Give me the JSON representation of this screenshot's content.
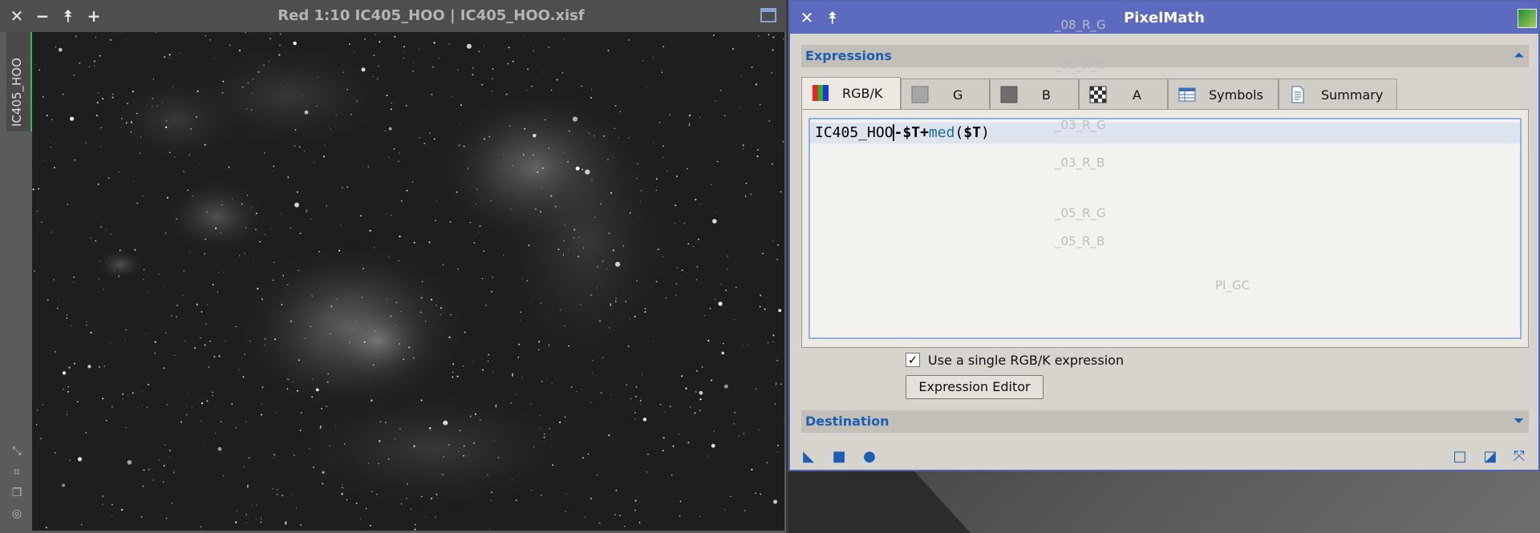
{
  "image_window": {
    "title": "Red 1:10 IC405_HOO | IC405_HOO.xisf",
    "view_tab": "IC405_HOO",
    "controls": [
      "close",
      "minimize",
      "shade",
      "maximize"
    ]
  },
  "pixelmath": {
    "title": "PixelMath",
    "expressions_section": "Expressions",
    "tabs": [
      {
        "label": "RGB/K",
        "icon": "rgb-channels-icon"
      },
      {
        "label": "G",
        "icon": "gray-swatch-icon"
      },
      {
        "label": "B",
        "icon": "dark-swatch-icon"
      },
      {
        "label": "A",
        "icon": "alpha-checker-icon"
      },
      {
        "label": "Symbols",
        "icon": "table-icon"
      },
      {
        "label": "Summary",
        "icon": "document-icon"
      }
    ],
    "expression": {
      "part1": "IC405_HOO",
      "op1": "-",
      "sym1": "$T",
      "op2": "+",
      "fn": "med",
      "paren_open": "(",
      "sym2": "$T",
      "paren_close": ")"
    },
    "single_expression_label": "Use a single RGB/K expression",
    "single_expression_checked": true,
    "expression_editor_button": "Expression Editor",
    "destination_section": "Destination",
    "ghost_icons": [
      "_08_R_G",
      "_08_R_B",
      "_03_R_G",
      "_03_R_B",
      "_05_R_G",
      "_05_R_B",
      "PI_GC"
    ]
  },
  "colors": {
    "pm_title": "#5c6bbf",
    "accent": "#1a5fb3",
    "view_tab_indicator": "#2fbf4a"
  }
}
